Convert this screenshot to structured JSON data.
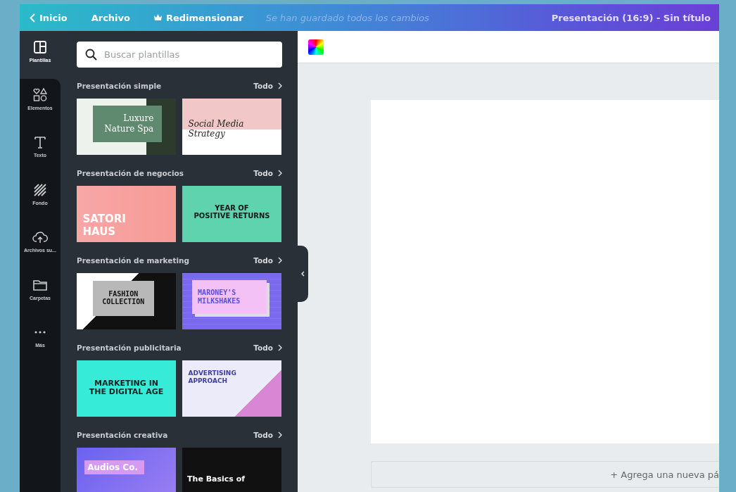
{
  "topbar": {
    "back": "Inicio",
    "menu": "Archivo",
    "resize": "Redimensionar",
    "save_status": "Se han guardado todos los cambios",
    "document_title": "Presentación (16:9) - Sin título"
  },
  "rail": [
    {
      "label": "Plantillas",
      "kind": "layout",
      "selected": true
    },
    {
      "label": "Elementos",
      "kind": "shapes",
      "selected": false
    },
    {
      "label": "Texto",
      "kind": "text",
      "selected": false
    },
    {
      "label": "Fondo",
      "kind": "hatch",
      "selected": false
    },
    {
      "label": "Archivos su...",
      "kind": "upload",
      "selected": false
    },
    {
      "label": "Carpetas",
      "kind": "folder",
      "selected": false
    },
    {
      "label": "Más",
      "kind": "more",
      "selected": false
    }
  ],
  "search": {
    "placeholder": "Buscar plantillas"
  },
  "sections": [
    {
      "title": "Presentación simple",
      "see_all": "Todo",
      "templates": [
        {
          "kind": "spa",
          "lines": [
            "Luxure",
            "Nature Spa"
          ]
        },
        {
          "kind": "social",
          "lines": [
            "Social Media",
            "Strategy"
          ]
        }
      ]
    },
    {
      "title": "Presentación de negocios",
      "see_all": "Todo",
      "templates": [
        {
          "kind": "satori",
          "lines": [
            "SATORI",
            "HAUS"
          ]
        },
        {
          "kind": "returns",
          "lines": [
            "YEAR OF",
            "POSITIVE RETURNS"
          ]
        }
      ]
    },
    {
      "title": "Presentación de marketing",
      "see_all": "Todo",
      "templates": [
        {
          "kind": "fashion",
          "lines": [
            "FASHION",
            "COLLECTION"
          ]
        },
        {
          "kind": "milkshake",
          "lines": [
            "MARONEY'S",
            "MILKSHAKES"
          ]
        }
      ]
    },
    {
      "title": "Presentación publicitaria",
      "see_all": "Todo",
      "templates": [
        {
          "kind": "digital",
          "lines": [
            "MARKETING IN",
            "THE DIGITAL AGE"
          ]
        },
        {
          "kind": "advertising",
          "lines": [
            "ADVERTISING",
            "APPROACH"
          ]
        }
      ]
    },
    {
      "title": "Presentación creativa",
      "see_all": "Todo",
      "templates": [
        {
          "kind": "audios",
          "lines": [
            "Audios Co."
          ]
        },
        {
          "kind": "basics",
          "lines": [
            "The Basics of"
          ]
        }
      ]
    }
  ],
  "add_page": "+ Agrega una nueva pá"
}
